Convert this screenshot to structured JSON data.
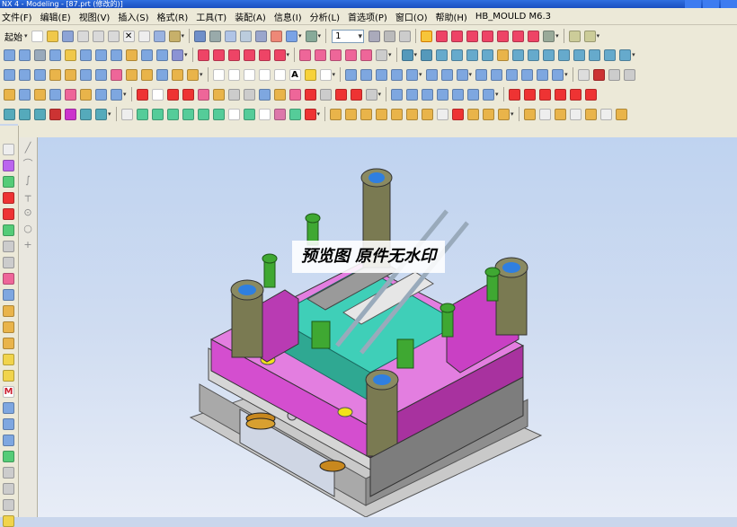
{
  "window": {
    "title": "NX 4 - Modeling - [87.prt (修改的)]"
  },
  "menu": {
    "items": [
      "文件(F)",
      "编辑(E)",
      "视图(V)",
      "插入(S)",
      "格式(R)",
      "工具(T)",
      "装配(A)",
      "信息(I)",
      "分析(L)",
      "首选项(P)",
      "窗口(O)",
      "帮助(H)",
      "HB_MOULD M6.3"
    ]
  },
  "toolbar": {
    "start_label": "起始",
    "layer_value": "1"
  },
  "watermark": {
    "text": "预览图 原件无水印"
  },
  "colors": {
    "plate_magenta": "#d84fcf",
    "pillar_olive": "#7a7a52",
    "steel_grey": "#b8b8b8",
    "core_cyan": "#3fcfb8",
    "bolt_green": "#3fa832",
    "ring_yellow": "#f2e21a"
  }
}
